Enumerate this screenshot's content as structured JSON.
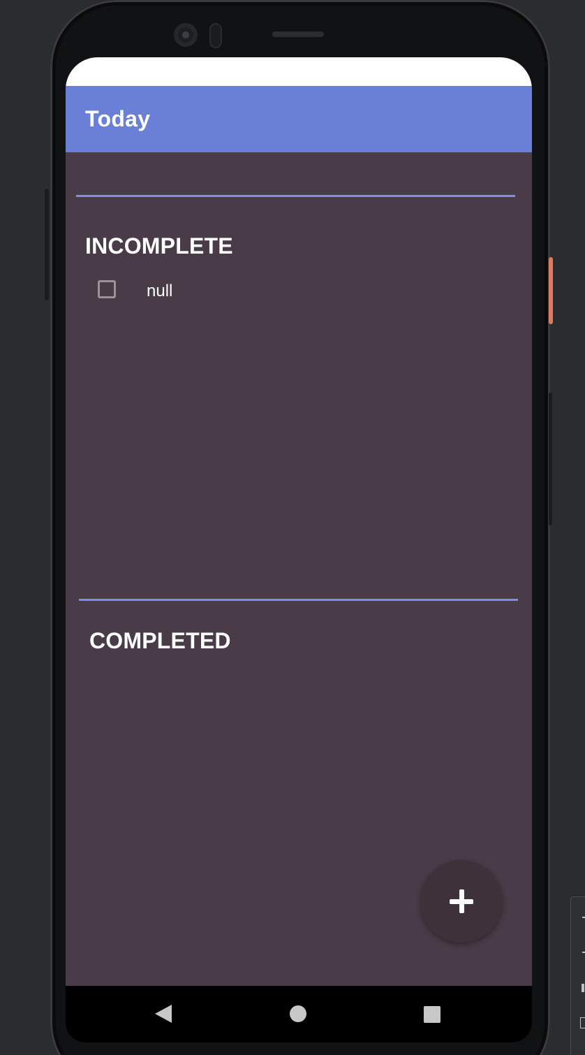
{
  "app_bar": {
    "title": "Today"
  },
  "sections": {
    "incomplete": {
      "heading": "INCOMPLETE",
      "tasks": [
        {
          "label": "null",
          "checked": false
        }
      ]
    },
    "completed": {
      "heading": "COMPLETED",
      "tasks": []
    }
  },
  "fab": {
    "icon": "plus-icon"
  },
  "nav_bar": {
    "icons": [
      "back-triangle-icon",
      "home-circle-icon",
      "recents-square-icon"
    ]
  },
  "colors": {
    "app_bar": "#6a7fd6",
    "background": "#493b47",
    "divider": "#7f8eea",
    "fab": "#3e3139"
  }
}
